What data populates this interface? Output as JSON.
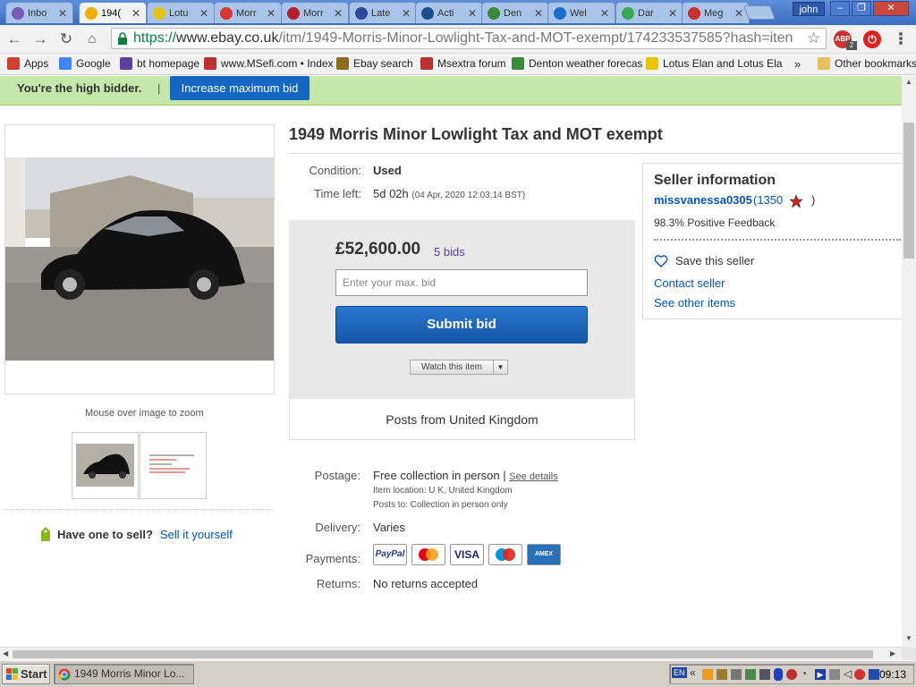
{
  "browser": {
    "tabs": [
      {
        "label": "Inbo",
        "color": "#7a5ab8"
      },
      {
        "label": "194(",
        "color": "#f5af02",
        "active": true
      },
      {
        "label": "Lotu",
        "color": "#e8c400"
      },
      {
        "label": "Morr",
        "color": "#d6382f"
      },
      {
        "label": "Morr",
        "color": "#b21e2d"
      },
      {
        "label": "Late",
        "color": "#2b4a9a"
      },
      {
        "label": "Acti",
        "color": "#1b4e8a"
      },
      {
        "label": "Den",
        "color": "#3a8a3a"
      },
      {
        "label": "Wel",
        "color": "#1a6fc9"
      },
      {
        "label": "Dar",
        "color": "#34a853"
      },
      {
        "label": "Meg",
        "color": "#c9302c"
      }
    ],
    "profile_name": "john",
    "url": {
      "scheme": "https://",
      "host": "www.ebay.co.uk",
      "path": "/itm/1949-Morris-Minor-Lowlight-Tax-and-MOT-exempt/174233537585?hash=iten"
    },
    "extension_badge": "2",
    "bookmarks": [
      {
        "label": "Apps",
        "color": "#d04030"
      },
      {
        "label": "Google",
        "color": "#4285f4"
      },
      {
        "label": "bt homepage",
        "color": "#5a3fa3"
      },
      {
        "label": "www.MSefi.com • Index",
        "color": "#c03030"
      },
      {
        "label": "Ebay search",
        "color": "#8a6d1d"
      },
      {
        "label": "Msextra forum",
        "color": "#c03030"
      },
      {
        "label": "Denton weather forecas",
        "color": "#3a8a3a"
      },
      {
        "label": "Lotus Elan and Lotus Ela",
        "color": "#e8c400"
      }
    ],
    "bookmarks_overflow": "»",
    "other_bookmarks": "Other bookmarks"
  },
  "banner": {
    "bidder_text": "You're the high bidder.",
    "separator": "|",
    "increase_button": "Increase maximum bid"
  },
  "gallery": {
    "zoom_hint": "Mouse over image to zoom"
  },
  "sell_promo": {
    "question": "Have one to sell?",
    "link": "Sell it yourself"
  },
  "listing": {
    "title": "1949 Morris Minor Lowlight Tax and MOT exempt",
    "condition_label": "Condition:",
    "condition_value": "Used",
    "time_left_label": "Time left:",
    "time_left_value": "5d 02h",
    "end_time": "(04 Apr, 2020  12:03:14 BST)"
  },
  "bid_box": {
    "price": "£52,600.00",
    "bids": "5 bids",
    "input_placeholder": "Enter your max. bid",
    "submit_label": "Submit bid",
    "watch_label": "Watch this item",
    "posts_from": "Posts from United Kingdom"
  },
  "shipping": {
    "postage_label": "Postage:",
    "postage_value": "Free collection in person",
    "separator": "|",
    "see_details": "See details",
    "item_location": "Item location:  U K, United Kingdom",
    "posts_to": "Posts to:  Collection in person only",
    "delivery_label": "Delivery:",
    "delivery_value": "Varies",
    "payments_label": "Payments:",
    "payment_methods": [
      "PayPal",
      "Mastercard",
      "VISA",
      "Maestro",
      "AMEX"
    ],
    "returns_label": "Returns:",
    "returns_value": "No returns accepted"
  },
  "seller": {
    "heading": "Seller information",
    "name": "missvanessa0305",
    "score": "(1350",
    "score_close": ")",
    "feedback": "98.3% Positive Feedback",
    "save_seller": "Save this seller",
    "contact": "Contact seller",
    "other_items": "See other items"
  },
  "taskbar": {
    "start": "Start",
    "window_title": "1949 Morris Minor Lo...",
    "tray_lang": "EN",
    "tray_chevron": "«",
    "clock": "09:13"
  }
}
